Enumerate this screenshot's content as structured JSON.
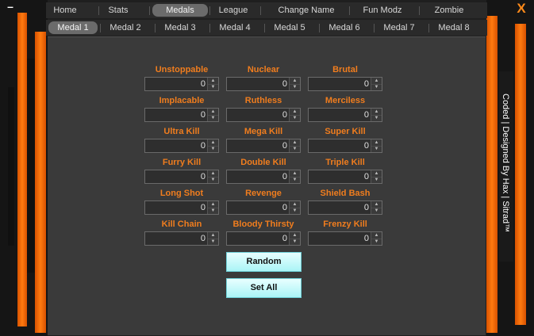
{
  "window": {
    "minimize_glyph": "–",
    "close_glyph": "X",
    "side_credit": "Coded | Designed By Hax | Sitrad™"
  },
  "topnav": [
    "Home",
    "Stats",
    "Medals",
    "League",
    "Change Name",
    "Fun Modz",
    "Zombie"
  ],
  "topnav_active": "Medals",
  "subnav": [
    "Medal 1",
    "Medal 2",
    "Medal 3",
    "Medal 4",
    "Medal 5",
    "Medal 6",
    "Medal 7",
    "Medal 8"
  ],
  "subnav_active": "Medal 1",
  "medals": [
    {
      "label": "Unstoppable",
      "value": "0"
    },
    {
      "label": "Nuclear",
      "value": "0"
    },
    {
      "label": "Brutal",
      "value": "0"
    },
    {
      "label": "Implacable",
      "value": "0"
    },
    {
      "label": "Ruthless",
      "value": "0"
    },
    {
      "label": "Merciless",
      "value": "0"
    },
    {
      "label": "Ultra Kill",
      "value": "0"
    },
    {
      "label": "Mega Kill",
      "value": "0"
    },
    {
      "label": "Super Kill",
      "value": "0"
    },
    {
      "label": "Furry Kill",
      "value": "0"
    },
    {
      "label": "Double Kill",
      "value": "0"
    },
    {
      "label": "Triple Kill",
      "value": "0"
    },
    {
      "label": "Long Shot",
      "value": "0"
    },
    {
      "label": "Revenge",
      "value": "0"
    },
    {
      "label": "Shield Bash",
      "value": "0"
    },
    {
      "label": "Kill Chain",
      "value": "0"
    },
    {
      "label": "Bloody Thirsty",
      "value": "0"
    },
    {
      "label": "Frenzy Kill",
      "value": "0"
    }
  ],
  "buttons": {
    "random": "Random",
    "set_all": "Set All"
  },
  "colors": {
    "accent": "#ff7a10",
    "label": "#f07d1e",
    "button": "#bff8f8"
  }
}
